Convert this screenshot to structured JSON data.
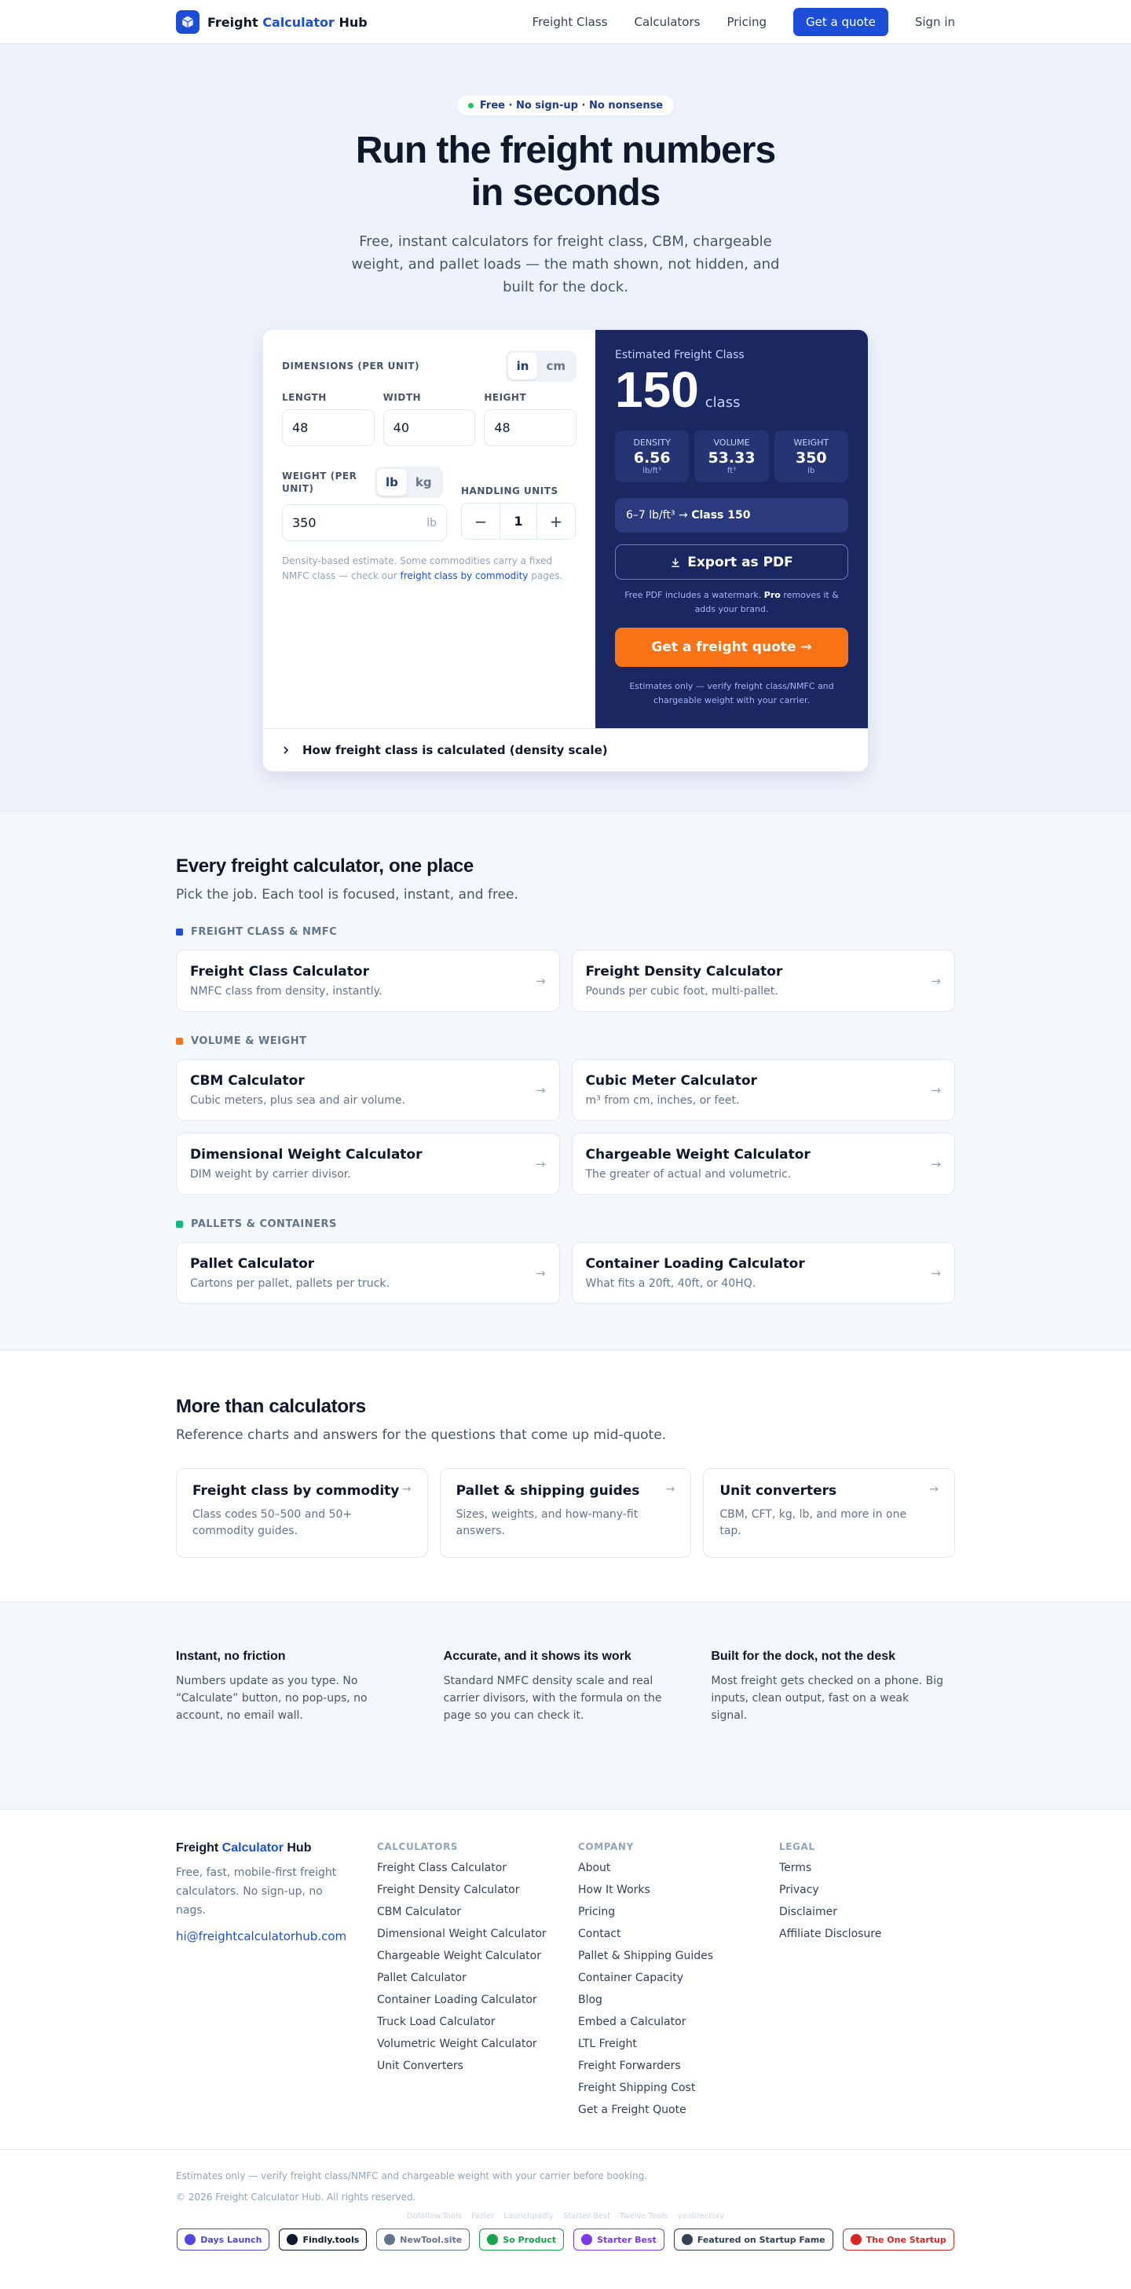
{
  "nav": {
    "logo_part1": "Freight",
    "logo_part2": "Calculator",
    "logo_part3": "Hub",
    "links": [
      "Freight Class",
      "Calculators",
      "Pricing"
    ],
    "cta": "Get a quote",
    "signin": "Sign in"
  },
  "hero": {
    "pill": "Free · No sign-up · No nonsense",
    "title": "Run the freight numbers in seconds",
    "subtitle": "Free, instant calculators for freight class, CBM, chargeable weight, and pallet loads — the math shown, not hidden, and built for the dock."
  },
  "calc": {
    "dims_label": "DIMENSIONS (PER UNIT)",
    "unit_in": "in",
    "unit_cm": "cm",
    "length_label": "LENGTH",
    "length_value": "48",
    "width_label": "WIDTH",
    "width_value": "40",
    "height_label": "HEIGHT",
    "height_value": "48",
    "weight_label": "WEIGHT (PER UNIT)",
    "unit_lb": "lb",
    "unit_kg": "kg",
    "weight_value": "350",
    "weight_suffix": "lb",
    "handling_label": "HANDLING UNITS",
    "minus": "−",
    "handling_value": "1",
    "plus": "+",
    "note_pre": "Density-based estimate. Some commodities carry a fixed NMFC class — check our ",
    "note_link": "freight class by commodity",
    "note_post": " pages.",
    "est_label": "Estimated Freight Class",
    "class_value": "150",
    "class_word": "class",
    "stats": [
      {
        "title": "DENSITY",
        "value": "6.56",
        "unit": "lb/ft³"
      },
      {
        "title": "VOLUME",
        "value": "53.33",
        "unit": "ft³"
      },
      {
        "title": "WEIGHT",
        "value": "350",
        "unit": "lb"
      }
    ],
    "band_range": "6–7 lb/ft³ →",
    "band_class": "Class 150",
    "export_btn": "Export as PDF",
    "pdf_note_pre": "Free PDF includes a watermark.",
    "pdf_note_pro": "Pro",
    "pdf_note_post": "removes it & adds your brand.",
    "quote_btn": "Get a freight quote →",
    "disclaimer": "Estimates only — verify freight class/NMFC and chargeable weight with your carrier.",
    "accordion": "How freight class is calculated (density scale)"
  },
  "tools": {
    "title": "Every freight calculator, one place",
    "lead": "Pick the job. Each tool is focused, instant, and free.",
    "cat1": "FREIGHT CLASS & NMFC",
    "cat1_items": [
      {
        "title": "Freight Class Calculator",
        "desc": "NMFC class from density, instantly."
      },
      {
        "title": "Freight Density Calculator",
        "desc": "Pounds per cubic foot, multi-pallet."
      }
    ],
    "cat2": "VOLUME & WEIGHT",
    "cat2_items": [
      {
        "title": "CBM Calculator",
        "desc": "Cubic meters, plus sea and air volume."
      },
      {
        "title": "Cubic Meter Calculator",
        "desc": "m³ from cm, inches, or feet."
      },
      {
        "title": "Dimensional Weight Calculator",
        "desc": "DIM weight by carrier divisor."
      },
      {
        "title": "Chargeable Weight Calculator",
        "desc": "The greater of actual and volumetric."
      }
    ],
    "cat3": "PALLETS & CONTAINERS",
    "cat3_items": [
      {
        "title": "Pallet Calculator",
        "desc": "Cartons per pallet, pallets per truck."
      },
      {
        "title": "Container Loading Calculator",
        "desc": "What fits a 20ft, 40ft, or 40HQ."
      }
    ],
    "colors": {
      "cat1": "#1d4ed8",
      "cat2": "#f97316",
      "cat3": "#10b981"
    }
  },
  "more": {
    "title": "More than calculators",
    "lead": "Reference charts and answers for the questions that come up mid-quote.",
    "items": [
      {
        "title": "Freight class by commodity",
        "desc": "Class codes 50–500 and 50+ commodity guides."
      },
      {
        "title": "Pallet & shipping guides",
        "desc": "Sizes, weights, and how-many-fit answers."
      },
      {
        "title": "Unit converters",
        "desc": "CBM, CFT, kg, lb, and more in one tap."
      }
    ]
  },
  "features": [
    {
      "title": "Instant, no friction",
      "desc": "Numbers update as you type. No “Calculate” button, no pop-ups, no account, no email wall."
    },
    {
      "title": "Accurate, and it shows its work",
      "desc": "Standard NMFC density scale and real carrier divisors, with the formula on the page so you can check it."
    },
    {
      "title": "Built for the dock, not the desk",
      "desc": "Most freight gets checked on a phone. Big inputs, clean output, fast on a weak signal."
    }
  ],
  "footer": {
    "desc": "Free, fast, mobile-first freight calculators. No sign-up, no nags.",
    "email": "hi@freightcalculatorhub.com",
    "calc_head": "CALCULATORS",
    "calc_links": [
      "Freight Class Calculator",
      "Freight Density Calculator",
      "CBM Calculator",
      "Dimensional Weight Calculator",
      "Chargeable Weight Calculator",
      "Pallet Calculator",
      "Container Loading Calculator",
      "Truck Load Calculator",
      "Volumetric Weight Calculator",
      "Unit Converters"
    ],
    "company_head": "COMPANY",
    "company_links": [
      "About",
      "How It Works",
      "Pricing",
      "Contact",
      "Pallet & Shipping Guides",
      "Container Capacity",
      "Blog",
      "Embed a Calculator",
      "LTL Freight",
      "Freight Forwarders",
      "Freight Shipping Cost",
      "Get a Freight Quote"
    ],
    "legal_head": "LEGAL",
    "legal_links": [
      "Terms",
      "Privacy",
      "Disclaimer",
      "Affiliate Disclosure"
    ],
    "bottom_note": "Estimates only — verify freight class/NMFC and chargeable weight with your carrier before booking.",
    "copyright": "© 2026 Freight Calculator Hub. All rights reserved.",
    "directories": [
      "Dofollow.Tools",
      "Fazier",
      "Launchpadly",
      "Starter Best",
      "Twelve Tools",
      "yo.directory"
    ],
    "badges": [
      {
        "label": "Days Launch",
        "color": "#4f46e5"
      },
      {
        "label": "Findly.tools",
        "color": "#0f172a"
      },
      {
        "label": "NewTool.site",
        "color": "#64748b"
      },
      {
        "label": "So Product",
        "color": "#16a34a"
      },
      {
        "label": "Starter Best",
        "color": "#7c3aed"
      },
      {
        "label": "Featured on Startup Fame",
        "color": "#334155"
      },
      {
        "label": "The One Startup",
        "color": "#dc2626"
      }
    ]
  }
}
